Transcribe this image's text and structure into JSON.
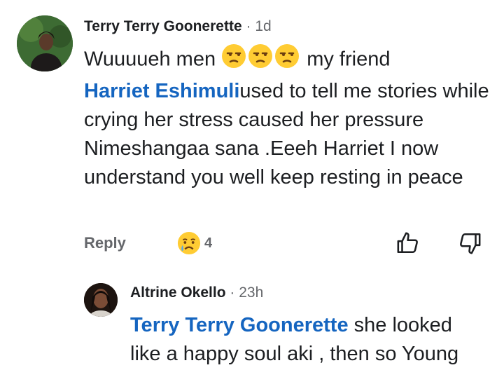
{
  "comment": {
    "author": "Terry Terry Goonerette",
    "separator": "·",
    "time": "1d",
    "text_before": "Wuuuueh men",
    "emoji_count": 3,
    "text_mid": " my friend",
    "mention": "Harriet Eshimuli",
    "text_after": "used to tell me stories while crying her stress caused her pressure Nimeshangaa  sana .Eeeh Harriet I now understand you well keep resting in peace",
    "actions": {
      "reply_label": "Reply",
      "reaction_icon": "crying-face-emoji",
      "reaction_count": "4",
      "like_icon": "thumbs-up-icon",
      "dislike_icon": "thumbs-down-icon"
    }
  },
  "reply": {
    "author": "Altrine Okello",
    "separator": "·",
    "time": "23h",
    "mention": "Terry Terry Goonerette",
    "text_line1": " she looked",
    "text_line2": "like a happy soul aki , then so Young"
  },
  "colors": {
    "mention": "#1565c0",
    "meta": "#65676b",
    "text": "#1c1e21"
  }
}
